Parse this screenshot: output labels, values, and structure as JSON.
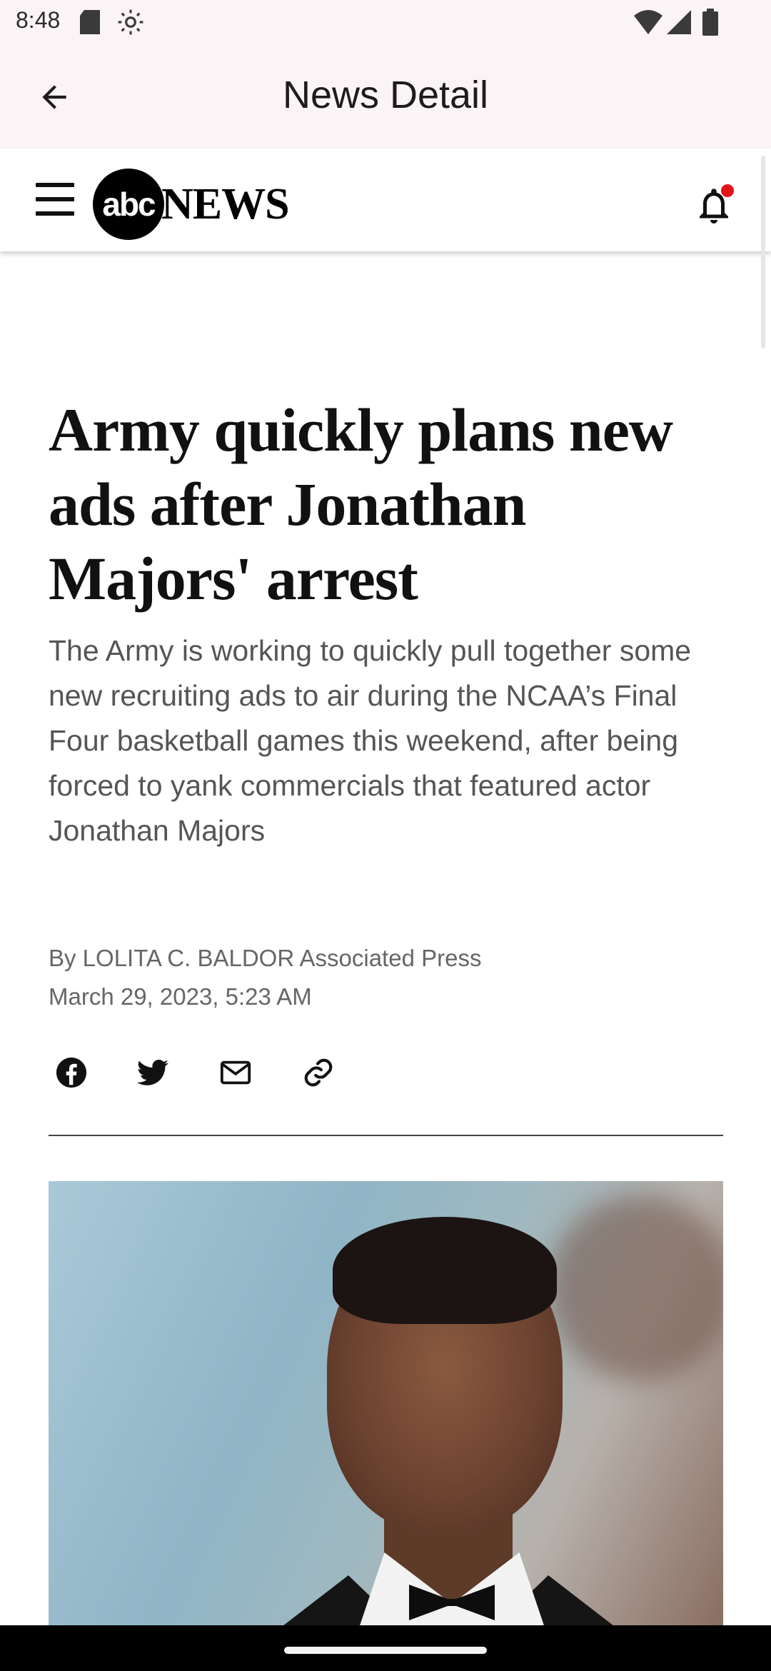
{
  "status_bar": {
    "time": "8:48",
    "icons": [
      "sd-card-icon",
      "settings-gear-icon",
      "wifi-icon",
      "signal-icon",
      "battery-icon"
    ]
  },
  "app_bar": {
    "title": "News Detail",
    "back_icon": "arrow-back-icon"
  },
  "site_header": {
    "logo_circle_text": "abc",
    "logo_wordmark": "NEWS",
    "menu_icon": "hamburger-menu-icon",
    "notification_icon": "bell-icon",
    "notification_dot_color": "#e3141a"
  },
  "article": {
    "headline": "Army quickly plans new ads after Jonathan Majors' arrest",
    "summary": "The Army is working to quickly pull together some new recruiting ads to air during the NCAA’s Final Four basketball games this weekend, after being forced to yank commercials that featured actor Jonathan Majors",
    "byline": "By LOLITA C. BALDOR Associated Press",
    "date": "March 29, 2023, 5:23 AM",
    "share_icons": [
      "facebook-icon",
      "twitter-icon",
      "email-icon",
      "link-icon"
    ]
  },
  "colors": {
    "app_bar_bg": "#fbf4f7",
    "headline": "#111111",
    "summary": "#555555",
    "meta": "#666666"
  }
}
